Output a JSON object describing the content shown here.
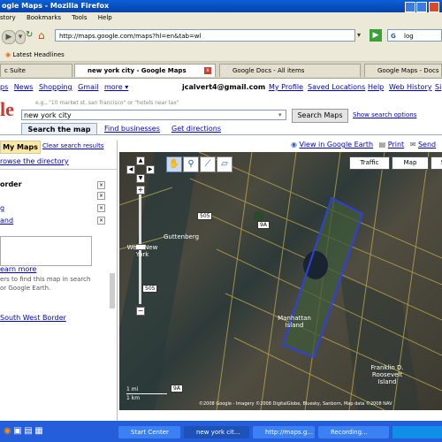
{
  "window": {
    "title": "ogle Maps - Mozilla Firefox"
  },
  "menu": {
    "items": [
      "story",
      "Bookmarks",
      "Tools",
      "Help"
    ]
  },
  "nav": {
    "url": "http://maps.google.com/maps?hl=en&tab=wl",
    "search_value": "log"
  },
  "bookmarks": {
    "latest_headlines": "Latest Headlines"
  },
  "tabs": [
    {
      "label": "c Suite"
    },
    {
      "label": "new york city - Google Maps"
    },
    {
      "label": "Google Docs - All items"
    },
    {
      "label": "Google Maps - Docs & S"
    }
  ],
  "gnav": {
    "links": [
      "ps",
      "News",
      "Shopping",
      "Gmail",
      "more ▾"
    ],
    "user": "jcalvert4@gmail.com",
    "right_links": [
      "My Profile",
      "Saved Locations",
      "Help",
      "Web History",
      "Si"
    ]
  },
  "search": {
    "hint": "e.g., \"10 market st, san francisco\" or \"hotels near lax\"",
    "value": "new york city",
    "button": "Search Maps",
    "show_options": "Show search options"
  },
  "page_tabs": {
    "search_map": "Search the map",
    "find_businesses": "Find businesses",
    "get_directions": "Get directions"
  },
  "sidebar": {
    "my_maps": "My Maps",
    "clear": "Clear search results",
    "browse": "rowse the directory",
    "border": "order",
    "item1": "g",
    "item2": "and",
    "learn_more": "earn more",
    "info": "ers to find this map in search",
    "info2": "or Google Earth.",
    "southwest": "South West Border"
  },
  "map_tools": {
    "view_earth": "View in Google Earth",
    "print": "Print",
    "send": "Send",
    "traffic": "Traffic",
    "map": "Map",
    "sat": "Sa"
  },
  "map_labels": {
    "guttenberg": "Guttenberg",
    "west_new_york": "West New York",
    "manhattan": "Manhattan Island",
    "franklin": "Franklin D. Roosevelt Island",
    "r505a": "505",
    "r505b": "505",
    "r9a_a": "9A",
    "r9a_b": "9A",
    "scale_mi": "1 mi",
    "scale_km": "1 km",
    "copyright": "©2008 Google - Imagery ©2008 DigitalGlobe, Bluesky, Sanborn, Map data ©2008 NAV"
  },
  "taskbar": {
    "items": [
      "Start Center",
      "new york cit...",
      "http://maps.g...",
      "Recording..."
    ]
  }
}
